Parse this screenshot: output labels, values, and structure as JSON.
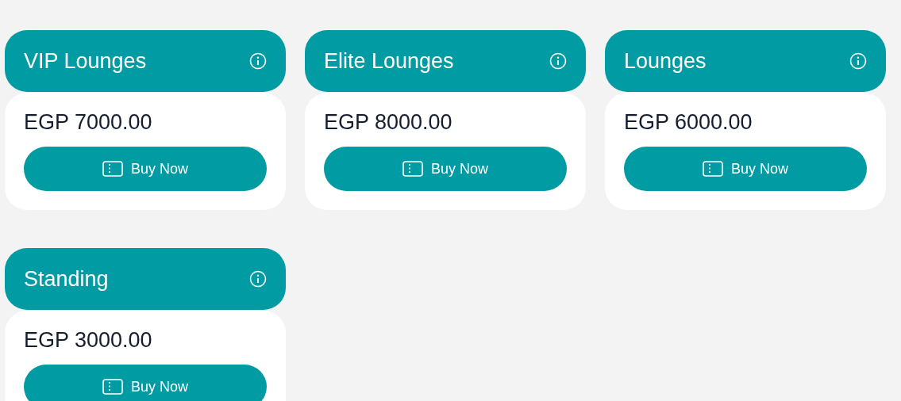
{
  "tickets": [
    {
      "name": "VIP Lounges",
      "price": "EGP 7000.00",
      "button": "Buy Now"
    },
    {
      "name": "Elite Lounges",
      "price": "EGP 8000.00",
      "button": "Buy Now"
    },
    {
      "name": "Lounges",
      "price": "EGP 6000.00",
      "button": "Buy Now"
    },
    {
      "name": "Standing",
      "price": "EGP 3000.00",
      "button": "Buy Now"
    }
  ]
}
